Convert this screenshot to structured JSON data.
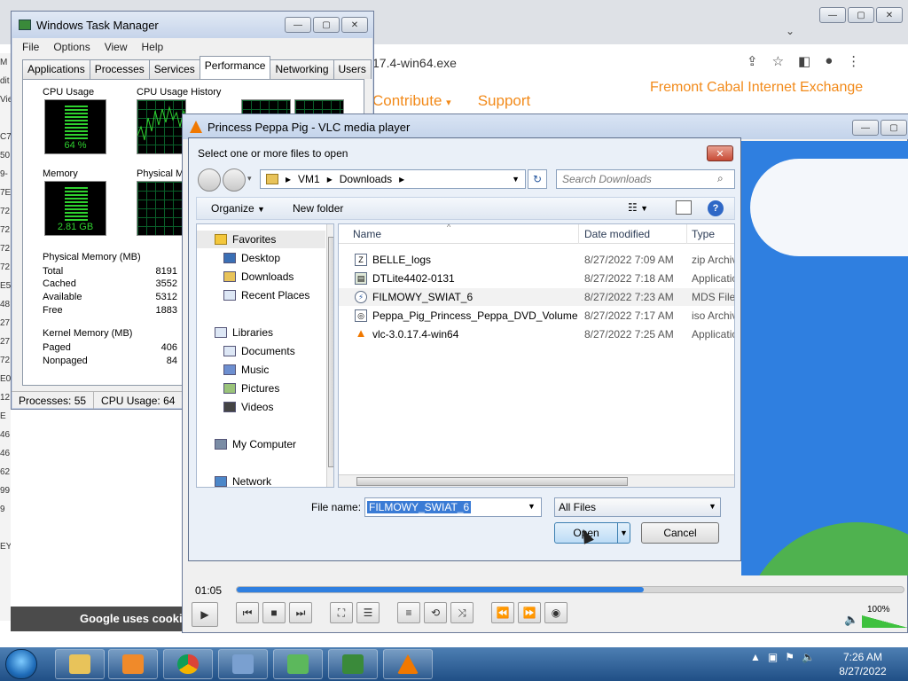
{
  "chrome": {
    "address": "17.4-win64.exe",
    "nav": [
      "Contribute",
      "Support"
    ],
    "brand": "Fremont Cabal Internet Exchange",
    "cookie_text": "Google uses cookie",
    "left_strip": [
      "M",
      "dit",
      "Vie",
      "",
      "C7",
      "50",
      "9-",
      "7E",
      "72",
      "72",
      "72",
      "72",
      "E5",
      "48",
      "27",
      "27",
      "72",
      "E0",
      "12",
      "E",
      "46",
      "46",
      "62",
      "99",
      "9",
      "",
      "EY"
    ]
  },
  "taskmgr": {
    "title": "Windows Task Manager",
    "menu": [
      "File",
      "Options",
      "View",
      "Help"
    ],
    "tabs": [
      "Applications",
      "Processes",
      "Services",
      "Performance",
      "Networking",
      "Users"
    ],
    "active_tab": "Performance",
    "cpu_usage_label": "CPU Usage",
    "cpu_usage_value": "64 %",
    "cpu_history_label": "CPU Usage History",
    "memory_label": "Memory",
    "memory_value": "2.81 GB",
    "phys_history_label": "Physical Me",
    "phys_mem_title": "Physical Memory (MB)",
    "phys_mem": [
      {
        "k": "Total",
        "v": "8191"
      },
      {
        "k": "Cached",
        "v": "3552"
      },
      {
        "k": "Available",
        "v": "5312"
      },
      {
        "k": "Free",
        "v": "1883"
      }
    ],
    "kernel_title": "Kernel Memory (MB)",
    "kernel": [
      {
        "k": "Paged",
        "v": "406"
      },
      {
        "k": "Nonpaged",
        "v": "84"
      }
    ],
    "status_processes": "Processes: 55",
    "status_cpu": "CPU Usage: 64"
  },
  "vlc": {
    "title": "Princess Peppa Pig - VLC media player",
    "time": "01:05",
    "progress": 0.61,
    "volume": "100%"
  },
  "dialog": {
    "title": "Select one or more files to open",
    "path": [
      "VM1",
      "Downloads"
    ],
    "search_placeholder": "Search Downloads",
    "organize": "Organize",
    "new_folder": "New folder",
    "nav": [
      {
        "label": "Favorites",
        "section": true
      },
      {
        "label": "Desktop"
      },
      {
        "label": "Downloads"
      },
      {
        "label": "Recent Places"
      },
      {
        "label": "Libraries",
        "section": true
      },
      {
        "label": "Documents"
      },
      {
        "label": "Music"
      },
      {
        "label": "Pictures"
      },
      {
        "label": "Videos"
      },
      {
        "label": "My Computer",
        "section": true
      },
      {
        "label": "Network",
        "section": true
      }
    ],
    "columns": {
      "name": "Name",
      "date": "Date modified",
      "type": "Type"
    },
    "files": [
      {
        "name": "BELLE_logs",
        "date": "8/27/2022 7:09 AM",
        "type": "zip Archiv"
      },
      {
        "name": "DTLite4402-0131",
        "date": "8/27/2022 7:18 AM",
        "type": "Applicatio"
      },
      {
        "name": "FILMOWY_SWIAT_6",
        "date": "8/27/2022 7:23 AM",
        "type": "MDS File"
      },
      {
        "name": "Peppa_Pig_Princess_Peppa_DVD_Volume",
        "date": "8/27/2022 7:17 AM",
        "type": "iso Archiv"
      },
      {
        "name": "vlc-3.0.17.4-win64",
        "date": "8/27/2022 7:25 AM",
        "type": "Applicatio"
      }
    ],
    "filename_label": "File name:",
    "filename_value": "FILMOWY_SWIAT_6",
    "filter": "All Files",
    "open": "Open",
    "cancel": "Cancel"
  },
  "taskbar": {
    "time": "7:26 AM",
    "date": "8/27/2022"
  },
  "colors": {
    "accent_orange": "#f28a1a",
    "vlc_blue": "#2f7fe0",
    "graph_green": "#2fd12f",
    "taskbar": "#2a5a92"
  }
}
